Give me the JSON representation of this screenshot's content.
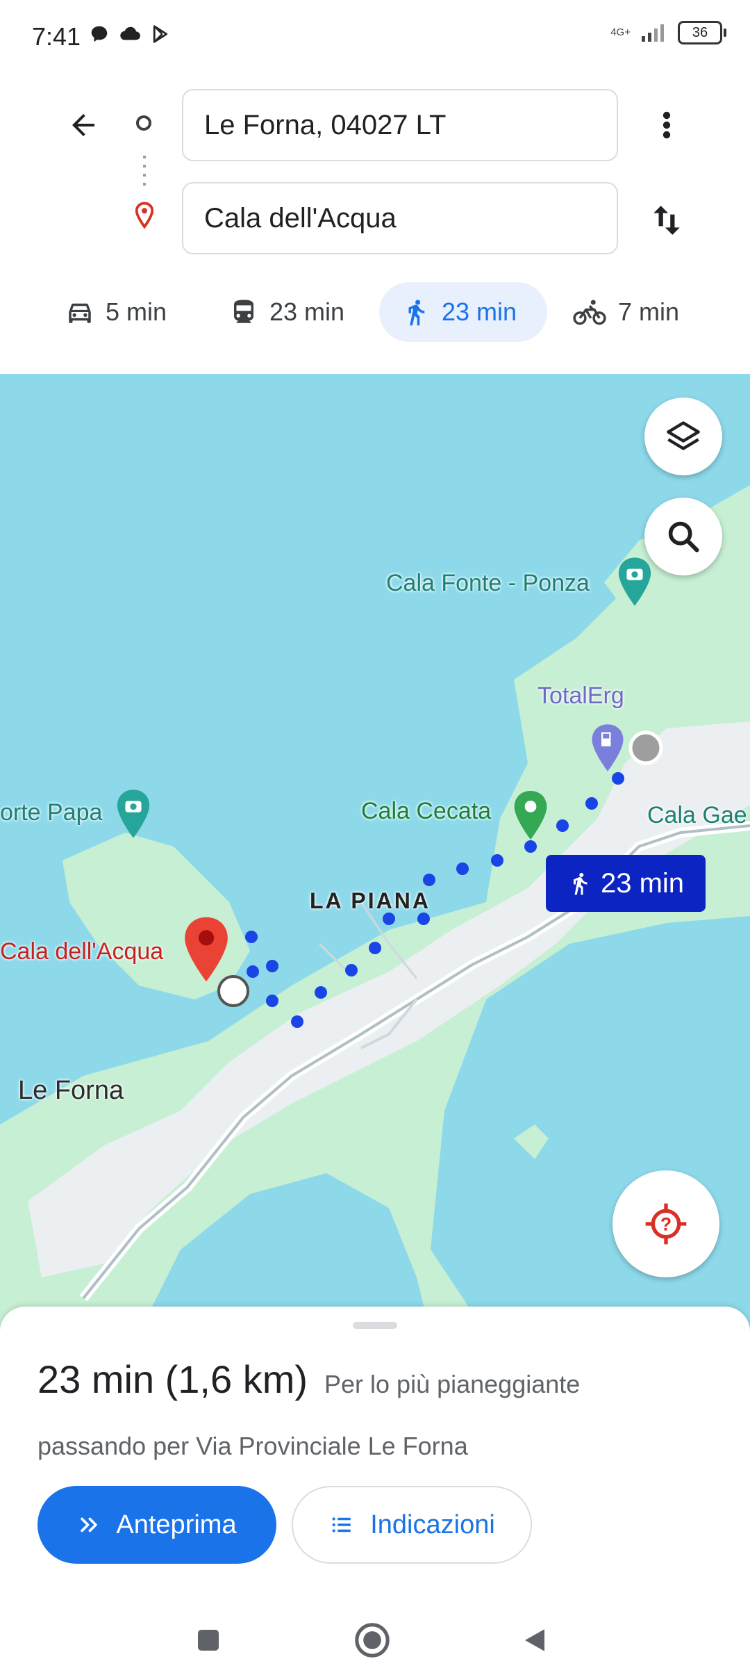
{
  "status_bar": {
    "time": "7:41",
    "network": "4G+",
    "battery": "36",
    "icons": [
      "chat-bubble-icon",
      "cloud-icon",
      "play-store-icon",
      "signal-icon",
      "battery-icon"
    ]
  },
  "directions": {
    "origin": "Le Forna, 04027 LT",
    "destination": "Cala dell'Acqua",
    "modes": [
      {
        "icon": "car-icon",
        "label": "5 min",
        "active": false
      },
      {
        "icon": "transit-icon",
        "label": "23 min",
        "active": false
      },
      {
        "icon": "walk-icon",
        "label": "23 min",
        "active": true
      },
      {
        "icon": "bike-icon",
        "label": "7 min",
        "active": false
      }
    ]
  },
  "map": {
    "labels": {
      "cala_fonte": "Cala Fonte - Ponza",
      "totalerg": "TotalErg",
      "forte_papa": "orte Papa",
      "cala_cecata": "Cala Cecata",
      "cala_gae": "Cala Gae",
      "la_piana": "LA PIANA",
      "cala_acqua": "Cala dell'Acqua",
      "le_forna": "Le Forna"
    },
    "route_chip": "23 min",
    "colors": {
      "water": "#8dd9ea",
      "land": "#c6efd4",
      "urban": "#eceff1",
      "route": "#1a45e6",
      "chip": "#0b24c2"
    }
  },
  "sheet": {
    "time_distance": "23 min (1,6 km)",
    "terrain": "Per lo più pianeggiante",
    "via": "passando per Via Provinciale Le Forna",
    "preview_label": "Anteprima",
    "directions_label": "Indicazioni"
  },
  "nav": {
    "icons": [
      "recents-square-icon",
      "home-circle-icon",
      "back-triangle-icon"
    ]
  }
}
